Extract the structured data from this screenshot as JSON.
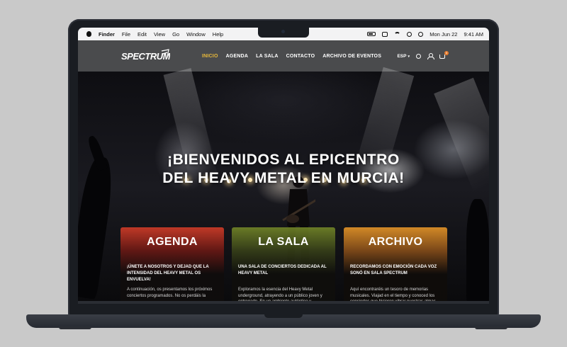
{
  "menubar": {
    "app": "Finder",
    "items": [
      "File",
      "Edit",
      "View",
      "Go",
      "Window",
      "Help"
    ],
    "date": "Mon Jun 22",
    "time": "9:41 AM"
  },
  "site": {
    "logo_text": "SPECTRUM",
    "nav": [
      "INICIO",
      "AGENDA",
      "LA SALA",
      "CONTACTO",
      "ARCHIVO DE EVENTOS"
    ],
    "active_nav": "INICIO",
    "language": "ESP",
    "cart_count": "0",
    "accent": "#e8b93a",
    "nav_bg": "#4a4b4d"
  },
  "hero": {
    "title_line1": "¡BIENVENIDOS AL EPICENTRO",
    "title_line2": "DEL HEAVY METAL EN MURCIA!"
  },
  "cards": [
    {
      "title": "AGENDA",
      "subtitle": "¡ÚNETE A NOSOTROS Y DEJAD QUE LA INTENSIDAD DEL HEAVY METAL OS ENVUELVA!",
      "body": "A continuación, os presentamos los próximos conciertos programados. No os perdáis la"
    },
    {
      "title": "LA SALA",
      "subtitle": "UNA SALA DE CONCIERTOS DEDICADA AL HEAVY METAL",
      "body": "Exploramos la esencia del Heavy Metal underground, atrayendo a un público joven y entregado. En un ambiente auténtico y"
    },
    {
      "title": "ARCHIVO",
      "subtitle": "RECORDAMOS CON EMOCIÓN CADA VOZ SONÓ EN SALA SPECTRUM",
      "body": "Aquí encontraréis un tesoro de memorias musicales. Viajad en el tiempo y conoced los conciertos que hicieron vibrar nuestras almas"
    }
  ]
}
